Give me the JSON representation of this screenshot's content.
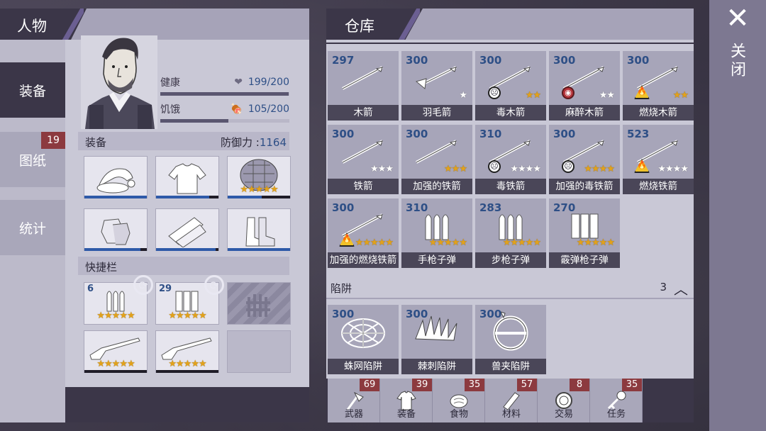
{
  "character_panel": {
    "title": "人物",
    "side_tabs": [
      {
        "label": "装备",
        "active": true
      },
      {
        "label": "图纸",
        "badge": "19"
      },
      {
        "label": "统计"
      }
    ],
    "stats": {
      "health": {
        "label": "健康",
        "icon": "heart-icon",
        "value": "199/200",
        "level": 0.995
      },
      "hunger": {
        "label": "饥饿",
        "icon": "meat-icon",
        "value": "105/200",
        "level": 0.525
      }
    },
    "equipment": {
      "label": "装备",
      "defense_label": "防御力 :",
      "defense_value": "1164",
      "slots": [
        {
          "item": "santa-hat",
          "durability": 1.0
        },
        {
          "item": "shirt",
          "durability": 0.85
        },
        {
          "item": "turtle-shell-armor",
          "stars": 5,
          "durability": 0.55
        },
        {
          "item": "gloves",
          "durability": 0.9
        },
        {
          "item": "pants",
          "durability": 0.95
        },
        {
          "item": "boots",
          "durability": 1.0
        }
      ]
    },
    "hotbar": {
      "label": "快捷栏",
      "slots": [
        {
          "item": "pistol-bullets",
          "count": "6",
          "stars": 5,
          "swap": true
        },
        {
          "item": "shotgun-shells",
          "count": "29",
          "stars": 5,
          "swap": true
        },
        {
          "item": "locked-slot"
        },
        {
          "item": "shotgun",
          "stars": 5
        },
        {
          "item": "shotgun-2",
          "stars": 5
        },
        {
          "item": "empty-slot"
        }
      ]
    }
  },
  "warehouse": {
    "title": "仓库",
    "items": [
      {
        "qty": "297",
        "name": "木箭",
        "stars": 0,
        "white_stars": 0
      },
      {
        "qty": "300",
        "name": "羽毛箭",
        "stars": 0,
        "white_stars": 1
      },
      {
        "qty": "300",
        "name": "毒木箭",
        "stars": 2,
        "white_stars": 0,
        "status": "poison"
      },
      {
        "qty": "300",
        "name": "麻醉木箭",
        "stars": 0,
        "white_stars": 2,
        "status": "sleep"
      },
      {
        "qty": "300",
        "name": "燃烧木箭",
        "stars": 2,
        "white_stars": 0,
        "status": "fire"
      },
      {
        "qty": "300",
        "name": "铁箭",
        "stars": 0,
        "white_stars": 3
      },
      {
        "qty": "300",
        "name": "加强的铁箭",
        "stars": 3,
        "white_stars": 0
      },
      {
        "qty": "310",
        "name": "毒铁箭",
        "stars": 0,
        "white_stars": 4,
        "status": "poison"
      },
      {
        "qty": "300",
        "name": "加强的毒铁箭",
        "stars": 4,
        "white_stars": 0,
        "status": "poison"
      },
      {
        "qty": "523",
        "name": "燃烧铁箭",
        "stars": 0,
        "white_stars": 4,
        "status": "fire"
      },
      {
        "qty": "300",
        "name": "加强的燃烧铁箭",
        "stars": 5,
        "white_stars": 0,
        "status": "fire"
      },
      {
        "qty": "310",
        "name": "手枪子弹",
        "stars": 5,
        "white_stars": 0
      },
      {
        "qty": "283",
        "name": "步枪子弹",
        "stars": 5,
        "white_stars": 0
      },
      {
        "qty": "270",
        "name": "霰弹枪子弹",
        "stars": 5,
        "white_stars": 0
      }
    ],
    "trap_section": {
      "label": "陷阱",
      "count": "3",
      "items": [
        {
          "qty": "300",
          "name": "蛛网陷阱"
        },
        {
          "qty": "300",
          "name": "棘刺陷阱"
        },
        {
          "qty": "300",
          "name": "兽夹陷阱"
        }
      ]
    },
    "categories": [
      {
        "label": "武器",
        "badge": "69",
        "icon": "axe-icon"
      },
      {
        "label": "装备",
        "badge": "39",
        "icon": "shirt-icon"
      },
      {
        "label": "食物",
        "badge": "35",
        "icon": "meat-icon"
      },
      {
        "label": "材料",
        "badge": "57",
        "icon": "plank-icon"
      },
      {
        "label": "交易",
        "badge": "8",
        "icon": "coin-icon"
      },
      {
        "label": "任务",
        "badge": "35",
        "icon": "key-icon"
      }
    ]
  },
  "close": {
    "label": "关闭"
  },
  "colors": {
    "panel_dark": "#3b3648",
    "qty_blue": "#2e4f86",
    "badge_red": "#8c3a3f",
    "star_gold": "#e3a21a"
  }
}
